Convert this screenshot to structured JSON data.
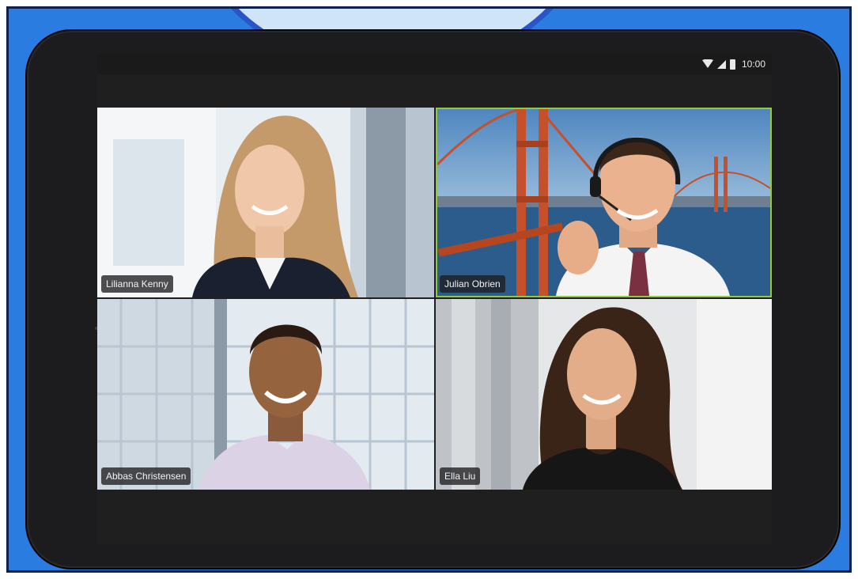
{
  "status_bar": {
    "time": "10:00",
    "icons": [
      "wifi-icon",
      "signal-icon",
      "battery-icon"
    ]
  },
  "participants": [
    {
      "name": "Lilianna Kenny",
      "active_speaker": false
    },
    {
      "name": "Julian Obrien",
      "active_speaker": true
    },
    {
      "name": "Abbas Christensen",
      "active_speaker": false
    },
    {
      "name": "Ella Liu",
      "active_speaker": false
    }
  ],
  "colors": {
    "frame_blue": "#2b7ce0",
    "tablet_body": "#1c1c1e",
    "screen_bg": "#1f1f20",
    "active_speaker_border": "#8fcb3a"
  }
}
